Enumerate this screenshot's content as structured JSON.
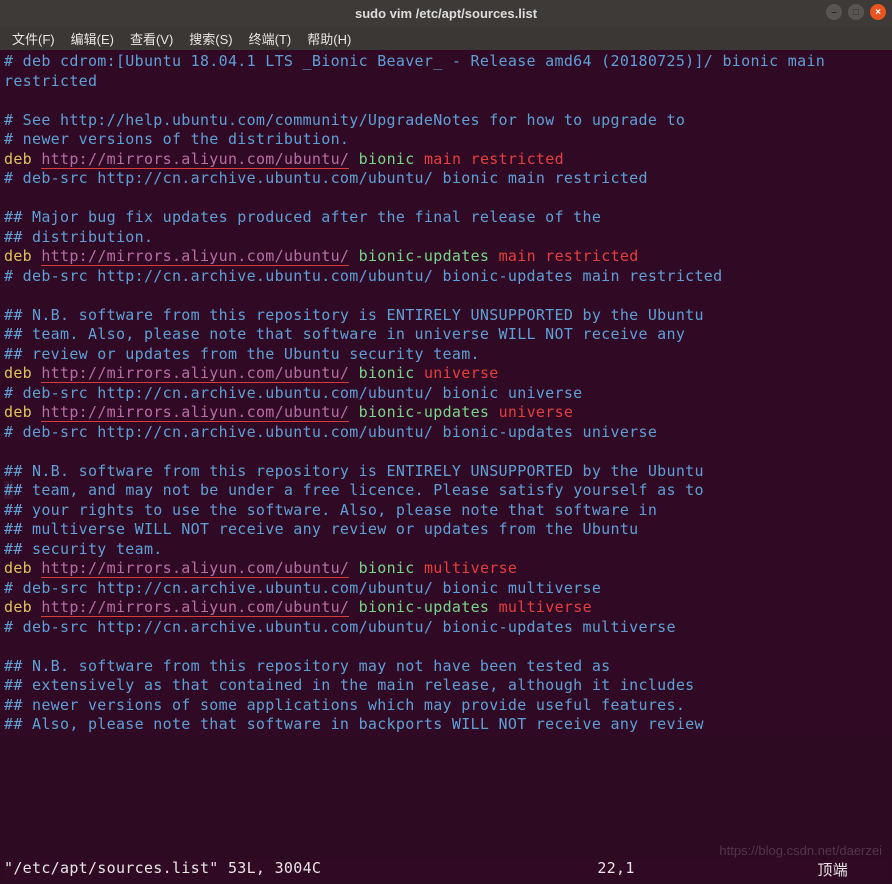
{
  "titlebar": {
    "title": "sudo vim /etc/apt/sources.list"
  },
  "menubar": {
    "items": [
      "文件(F)",
      "编辑(E)",
      "查看(V)",
      "搜索(S)",
      "终端(T)",
      "帮助(H)"
    ]
  },
  "editor": {
    "lines": [
      {
        "t": "comment",
        "text": "# deb cdrom:[Ubuntu 18.04.1 LTS _Bionic Beaver_ - Release amd64 (20180725)]/ bionic main restricted"
      },
      {
        "t": "blank",
        "text": ""
      },
      {
        "t": "comment",
        "text": "# See http://help.ubuntu.com/community/UpgradeNotes for how to upgrade to"
      },
      {
        "t": "comment",
        "text": "# newer versions of the distribution."
      },
      {
        "t": "deb",
        "deb": "deb",
        "url": "http://mirrors.aliyun.com/ubuntu/",
        "suite": "bionic",
        "comps": "main restricted",
        "ul": true
      },
      {
        "t": "comment",
        "text": "# deb-src http://cn.archive.ubuntu.com/ubuntu/ bionic main restricted"
      },
      {
        "t": "blank",
        "text": ""
      },
      {
        "t": "comment",
        "text": "## Major bug fix updates produced after the final release of the"
      },
      {
        "t": "comment",
        "text": "## distribution."
      },
      {
        "t": "deb",
        "deb": "deb",
        "url": "http://mirrors.aliyun.com/ubuntu/",
        "suite": "bionic-updates",
        "comps": "main restricted",
        "ul": true
      },
      {
        "t": "comment",
        "text": "# deb-src http://cn.archive.ubuntu.com/ubuntu/ bionic-updates main restricted"
      },
      {
        "t": "blank",
        "text": ""
      },
      {
        "t": "comment",
        "text": "## N.B. software from this repository is ENTIRELY UNSUPPORTED by the Ubuntu"
      },
      {
        "t": "comment",
        "text": "## team. Also, please note that software in universe WILL NOT receive any"
      },
      {
        "t": "comment",
        "text": "## review or updates from the Ubuntu security team."
      },
      {
        "t": "deb",
        "deb": "deb",
        "url": "http://mirrors.aliyun.com/ubuntu/",
        "suite": "bionic",
        "comps": "universe",
        "ul": true
      },
      {
        "t": "comment",
        "text": "# deb-src http://cn.archive.ubuntu.com/ubuntu/ bionic universe"
      },
      {
        "t": "deb",
        "deb": "deb",
        "url": "http://mirrors.aliyun.com/ubuntu/",
        "suite": "bionic-updates",
        "comps": "universe",
        "ul": true
      },
      {
        "t": "comment",
        "text": "# deb-src http://cn.archive.ubuntu.com/ubuntu/ bionic-updates universe"
      },
      {
        "t": "blank",
        "text": ""
      },
      {
        "t": "comment",
        "text": "## N.B. software from this repository is ENTIRELY UNSUPPORTED by the Ubuntu"
      },
      {
        "t": "comment-cursor",
        "prefix": "#",
        "rest": "# team, and may not be under a free licence. Please satisfy yourself as to"
      },
      {
        "t": "comment",
        "text": "## your rights to use the software. Also, please note that software in"
      },
      {
        "t": "comment",
        "text": "## multiverse WILL NOT receive any review or updates from the Ubuntu"
      },
      {
        "t": "comment",
        "text": "## security team."
      },
      {
        "t": "deb",
        "deb": "deb",
        "url": "http://mirrors.aliyun.com/ubuntu/",
        "suite": "bionic",
        "comps": "multiverse",
        "ul": true
      },
      {
        "t": "comment",
        "text": "# deb-src http://cn.archive.ubuntu.com/ubuntu/ bionic multiverse"
      },
      {
        "t": "deb",
        "deb": "deb",
        "url": "http://mirrors.aliyun.com/ubuntu/",
        "suite": "bionic-updates",
        "comps": "multiverse",
        "ul": true
      },
      {
        "t": "comment",
        "text": "# deb-src http://cn.archive.ubuntu.com/ubuntu/ bionic-updates multiverse"
      },
      {
        "t": "blank",
        "text": ""
      },
      {
        "t": "comment",
        "text": "## N.B. software from this repository may not have been tested as"
      },
      {
        "t": "comment",
        "text": "## extensively as that contained in the main release, although it includes"
      },
      {
        "t": "comment",
        "text": "## newer versions of some applications which may provide useful features."
      },
      {
        "t": "comment",
        "text": "## Also, please note that software in backports WILL NOT receive any review"
      }
    ]
  },
  "status": {
    "left": "\"/etc/apt/sources.list\" 53L, 3004C",
    "mid": "22,1",
    "right": "顶端"
  },
  "watermark": "https://blog.csdn.net/daerzei"
}
